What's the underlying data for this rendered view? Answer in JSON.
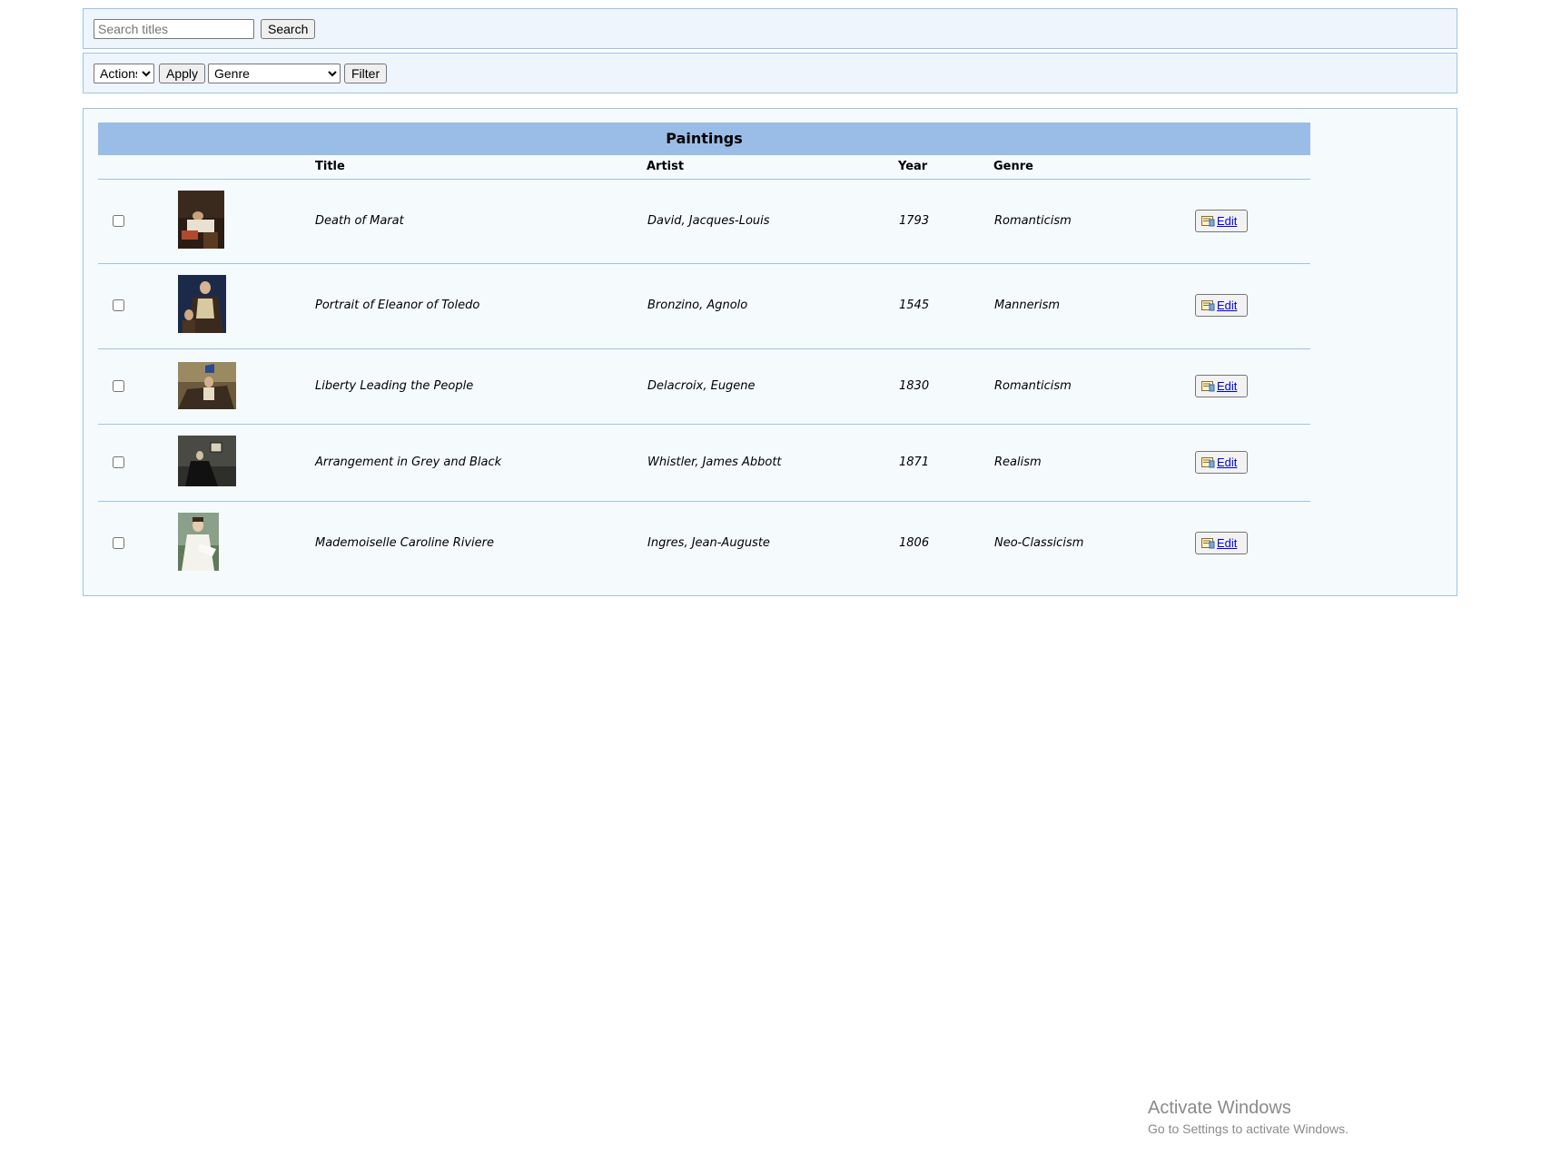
{
  "search": {
    "placeholder": "Search titles",
    "value": "",
    "button_label": "Search"
  },
  "filters": {
    "actions_selected": "Actions",
    "apply_label": "Apply",
    "genre_selected": "Genre",
    "filter_label": "Filter"
  },
  "table": {
    "caption": "Paintings",
    "columns": [
      "Title",
      "Artist",
      "Year",
      "Genre"
    ],
    "rows": [
      {
        "title": "Death of Marat",
        "artist": "David, Jacques-Louis",
        "year": "1793",
        "genre": "Romanticism",
        "checked": false,
        "edit_label": "Edit"
      },
      {
        "title": "Portrait of Eleanor of Toledo",
        "artist": "Bronzino, Agnolo",
        "year": "1545",
        "genre": "Mannerism",
        "checked": false,
        "edit_label": "Edit"
      },
      {
        "title": "Liberty Leading the People",
        "artist": "Delacroix, Eugene",
        "year": "1830",
        "genre": "Romanticism",
        "checked": false,
        "edit_label": "Edit"
      },
      {
        "title": "Arrangement in Grey and Black",
        "artist": "Whistler, James Abbott",
        "year": "1871",
        "genre": "Realism",
        "checked": false,
        "edit_label": "Edit"
      },
      {
        "title": "Mademoiselle Caroline Riviere",
        "artist": "Ingres, Jean-Auguste",
        "year": "1806",
        "genre": "Neo-Classicism",
        "checked": false,
        "edit_label": "Edit"
      }
    ]
  },
  "watermark": {
    "title": "Activate Windows",
    "subtitle": "Go to Settings to activate Windows."
  },
  "colors": {
    "panel_bg": "#eef5fc",
    "panel_border": "#9ec3e6",
    "caption_bg": "#99bde6",
    "link": "#0000ee"
  }
}
